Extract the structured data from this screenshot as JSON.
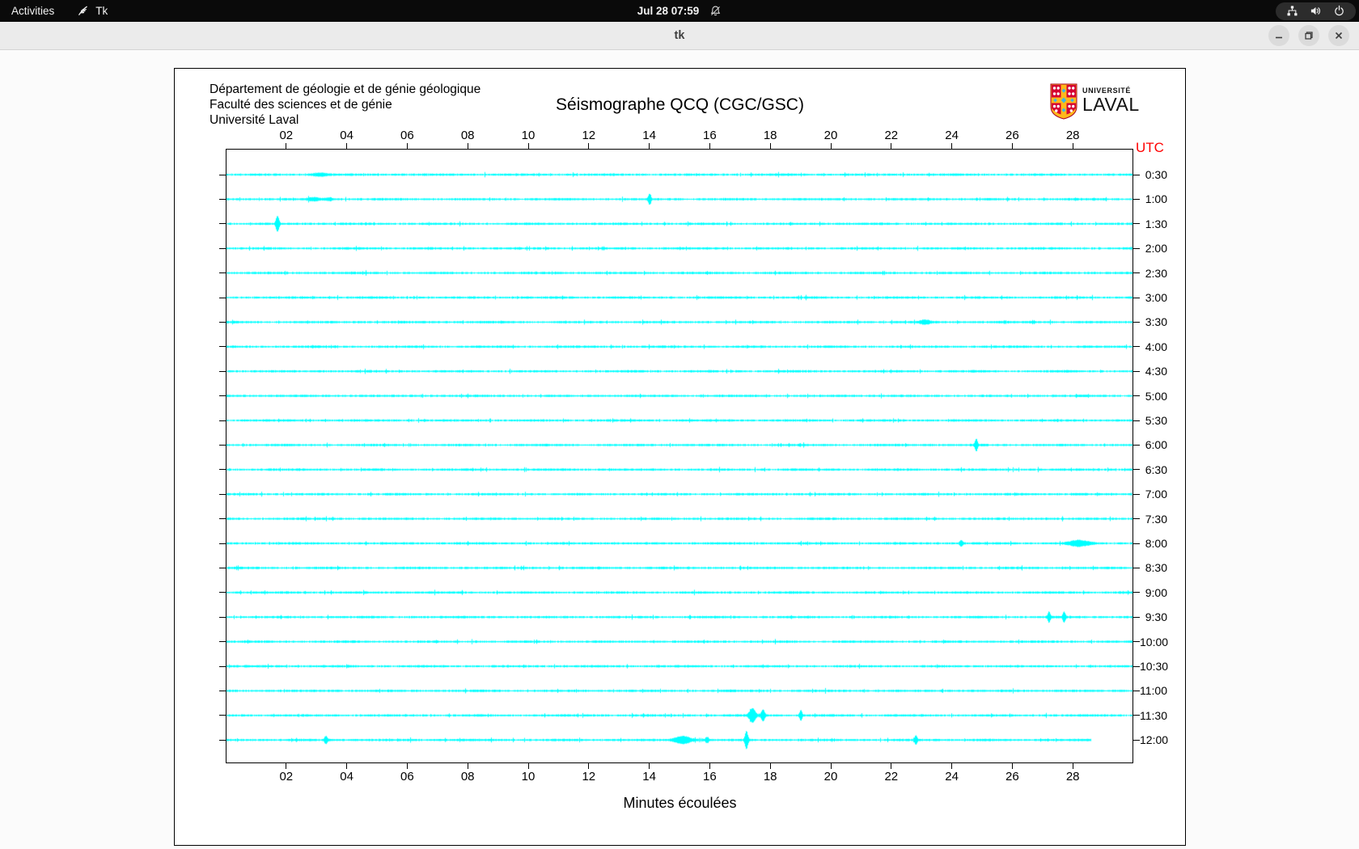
{
  "top_bar": {
    "activities_label": "Activities",
    "app_name": "Tk",
    "clock": "Jul 28 07:59",
    "notifications_muted": true,
    "status_icons": [
      "network-wired-icon",
      "volume-icon",
      "power-icon"
    ]
  },
  "window": {
    "title": "tk",
    "controls": [
      "minimize",
      "maximize",
      "close"
    ]
  },
  "chart": {
    "header_lines": [
      "Département de géologie et de génie géologique",
      "Faculté des sciences et de génie",
      "Université Laval"
    ],
    "title": "Séismographe QCQ (CGC/GSC)",
    "logo": {
      "small": "UNIVERSITÉ",
      "large": "LAVAL"
    }
  },
  "chart_data": {
    "type": "helicorder",
    "title": "Séismographe QCQ (CGC/GSC)",
    "x_axis": {
      "label": "Minutes écoulées",
      "ticks": [
        "02",
        "04",
        "06",
        "08",
        "10",
        "12",
        "14",
        "16",
        "18",
        "20",
        "22",
        "24",
        "26",
        "28"
      ],
      "range_minutes": [
        0,
        30
      ]
    },
    "y_axis": {
      "label": "UTC",
      "rows": [
        "0:30",
        "1:00",
        "1:30",
        "2:00",
        "2:30",
        "3:00",
        "3:30",
        "4:00",
        "4:30",
        "5:00",
        "5:30",
        "6:00",
        "6:30",
        "7:00",
        "7:30",
        "8:00",
        "8:30",
        "9:00",
        "9:30",
        "10:00",
        "10:30",
        "11:00",
        "11:30",
        "12:00"
      ]
    },
    "row_interval_minutes": 30,
    "trace_color": "#00ffff",
    "axis_color": "#000000",
    "utc_label_color": "#ff0000",
    "last_row_end_minute": 28.6,
    "events": [
      {
        "row": "0:30",
        "minute": 3.1,
        "amplitude": 1.5,
        "width": 0.3
      },
      {
        "row": "1:00",
        "minute": 2.9,
        "amplitude": 1.6,
        "width": 0.2
      },
      {
        "row": "1:00",
        "minute": 3.4,
        "amplitude": 1.4,
        "width": 0.15
      },
      {
        "row": "1:00",
        "minute": 14.0,
        "amplitude": 6,
        "width": 0.05
      },
      {
        "row": "1:30",
        "minute": 1.7,
        "amplitude": 9,
        "width": 0.06
      },
      {
        "row": "3:30",
        "minute": 23.1,
        "amplitude": 2,
        "width": 0.2
      },
      {
        "row": "6:00",
        "minute": 24.8,
        "amplitude": 7,
        "width": 0.05
      },
      {
        "row": "8:00",
        "minute": 24.3,
        "amplitude": 3,
        "width": 0.06
      },
      {
        "row": "8:00",
        "minute": 28.2,
        "amplitude": 3,
        "width": 0.35
      },
      {
        "row": "9:30",
        "minute": 27.2,
        "amplitude": 6,
        "width": 0.05
      },
      {
        "row": "9:30",
        "minute": 27.7,
        "amplitude": 6,
        "width": 0.05
      },
      {
        "row": "11:30",
        "minute": 17.4,
        "amplitude": 8,
        "width": 0.12
      },
      {
        "row": "11:30",
        "minute": 17.75,
        "amplitude": 6,
        "width": 0.07
      },
      {
        "row": "11:30",
        "minute": 19.0,
        "amplitude": 6,
        "width": 0.05
      },
      {
        "row": "12:00",
        "minute": 3.3,
        "amplitude": 4,
        "width": 0.06
      },
      {
        "row": "12:00",
        "minute": 15.1,
        "amplitude": 4,
        "width": 0.3
      },
      {
        "row": "12:00",
        "minute": 15.9,
        "amplitude": 3,
        "width": 0.07
      },
      {
        "row": "12:00",
        "minute": 17.2,
        "amplitude": 10,
        "width": 0.06
      },
      {
        "row": "12:00",
        "minute": 22.8,
        "amplitude": 5,
        "width": 0.05
      }
    ]
  }
}
